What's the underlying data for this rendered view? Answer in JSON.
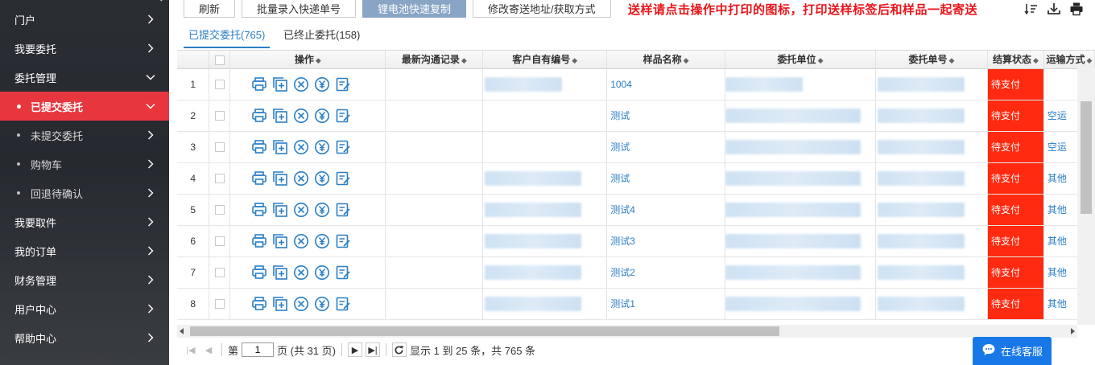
{
  "sidebar": {
    "items": [
      {
        "label": "门户",
        "type": "top",
        "chevron": "right"
      },
      {
        "label": "我要委托",
        "type": "top",
        "chevron": "right"
      },
      {
        "label": "委托管理",
        "type": "top",
        "chevron": "down"
      },
      {
        "label": "已提交委托",
        "type": "sub",
        "chevron": "down",
        "active": true
      },
      {
        "label": "未提交委托",
        "type": "sub",
        "chevron": "right"
      },
      {
        "label": "购物车",
        "type": "sub",
        "chevron": "right"
      },
      {
        "label": "回退待确认",
        "type": "sub",
        "chevron": "right"
      },
      {
        "label": "我要取件",
        "type": "top",
        "chevron": "right"
      },
      {
        "label": "我的订单",
        "type": "top",
        "chevron": "right"
      },
      {
        "label": "财务管理",
        "type": "top",
        "chevron": "right"
      },
      {
        "label": "用户中心",
        "type": "top",
        "chevron": "right"
      },
      {
        "label": "帮助中心",
        "type": "top",
        "chevron": "right"
      }
    ]
  },
  "toolbar": {
    "refresh": "刷新",
    "batch_express": "批量录入快递单号",
    "battery_copy": "锂电池快速复制",
    "modify_address": "修改寄送地址/获取方式",
    "notice": "送样请点击操作中打印的图标，打印送样标签后和样品一起寄送"
  },
  "tabs": [
    {
      "label": "已提交委托(765)",
      "active": true
    },
    {
      "label": "已终止委托(158)",
      "active": false
    }
  ],
  "table": {
    "columns": [
      "操作",
      "最新沟通记录",
      "客户自有编号",
      "样品名称",
      "委托单位",
      "委托单号",
      "结算状态",
      "运输方式"
    ],
    "rows": [
      {
        "num": "1",
        "sample": "1004",
        "status": "待支付",
        "transport": ""
      },
      {
        "num": "2",
        "sample": "测试",
        "status": "待支付",
        "transport": "空运"
      },
      {
        "num": "3",
        "sample": "测试",
        "status": "待支付",
        "transport": "空运"
      },
      {
        "num": "4",
        "sample": "测试",
        "status": "待支付",
        "transport": "其他"
      },
      {
        "num": "5",
        "sample": "测试4",
        "status": "待支付",
        "transport": "其他"
      },
      {
        "num": "6",
        "sample": "测试3",
        "status": "待支付",
        "transport": "其他"
      },
      {
        "num": "7",
        "sample": "测试2",
        "status": "待支付",
        "transport": "其他"
      },
      {
        "num": "8",
        "sample": "测试1",
        "status": "待支付",
        "transport": "其他"
      }
    ]
  },
  "pager": {
    "page_label": "第",
    "page_value": "1",
    "total_label": "页 (共 31 页)",
    "summary": "显示 1 到 25 条，共 765 条"
  },
  "chat": {
    "label": "在线客服"
  },
  "colors": {
    "active_menu": "#e8363f",
    "status_red": "#ff2a10",
    "link": "#2a7ec5",
    "chat": "#1878e8"
  }
}
